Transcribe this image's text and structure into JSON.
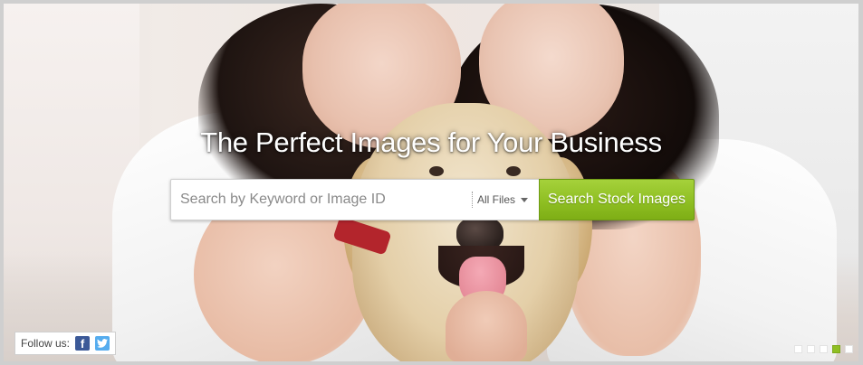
{
  "hero": {
    "headline": "The Perfect Images for Your Business"
  },
  "search": {
    "placeholder": "Search by Keyword or Image ID",
    "value": "",
    "filter_label": "All Files",
    "button_label": "Search Stock Images"
  },
  "social": {
    "follow_label": "Follow us:",
    "icons": [
      "facebook-icon",
      "twitter-icon"
    ]
  },
  "slider": {
    "slide_count": 5,
    "active_index": 4
  },
  "colors": {
    "accent_green": "#8fbf23",
    "facebook_blue": "#3b5998",
    "twitter_blue": "#55acee"
  }
}
